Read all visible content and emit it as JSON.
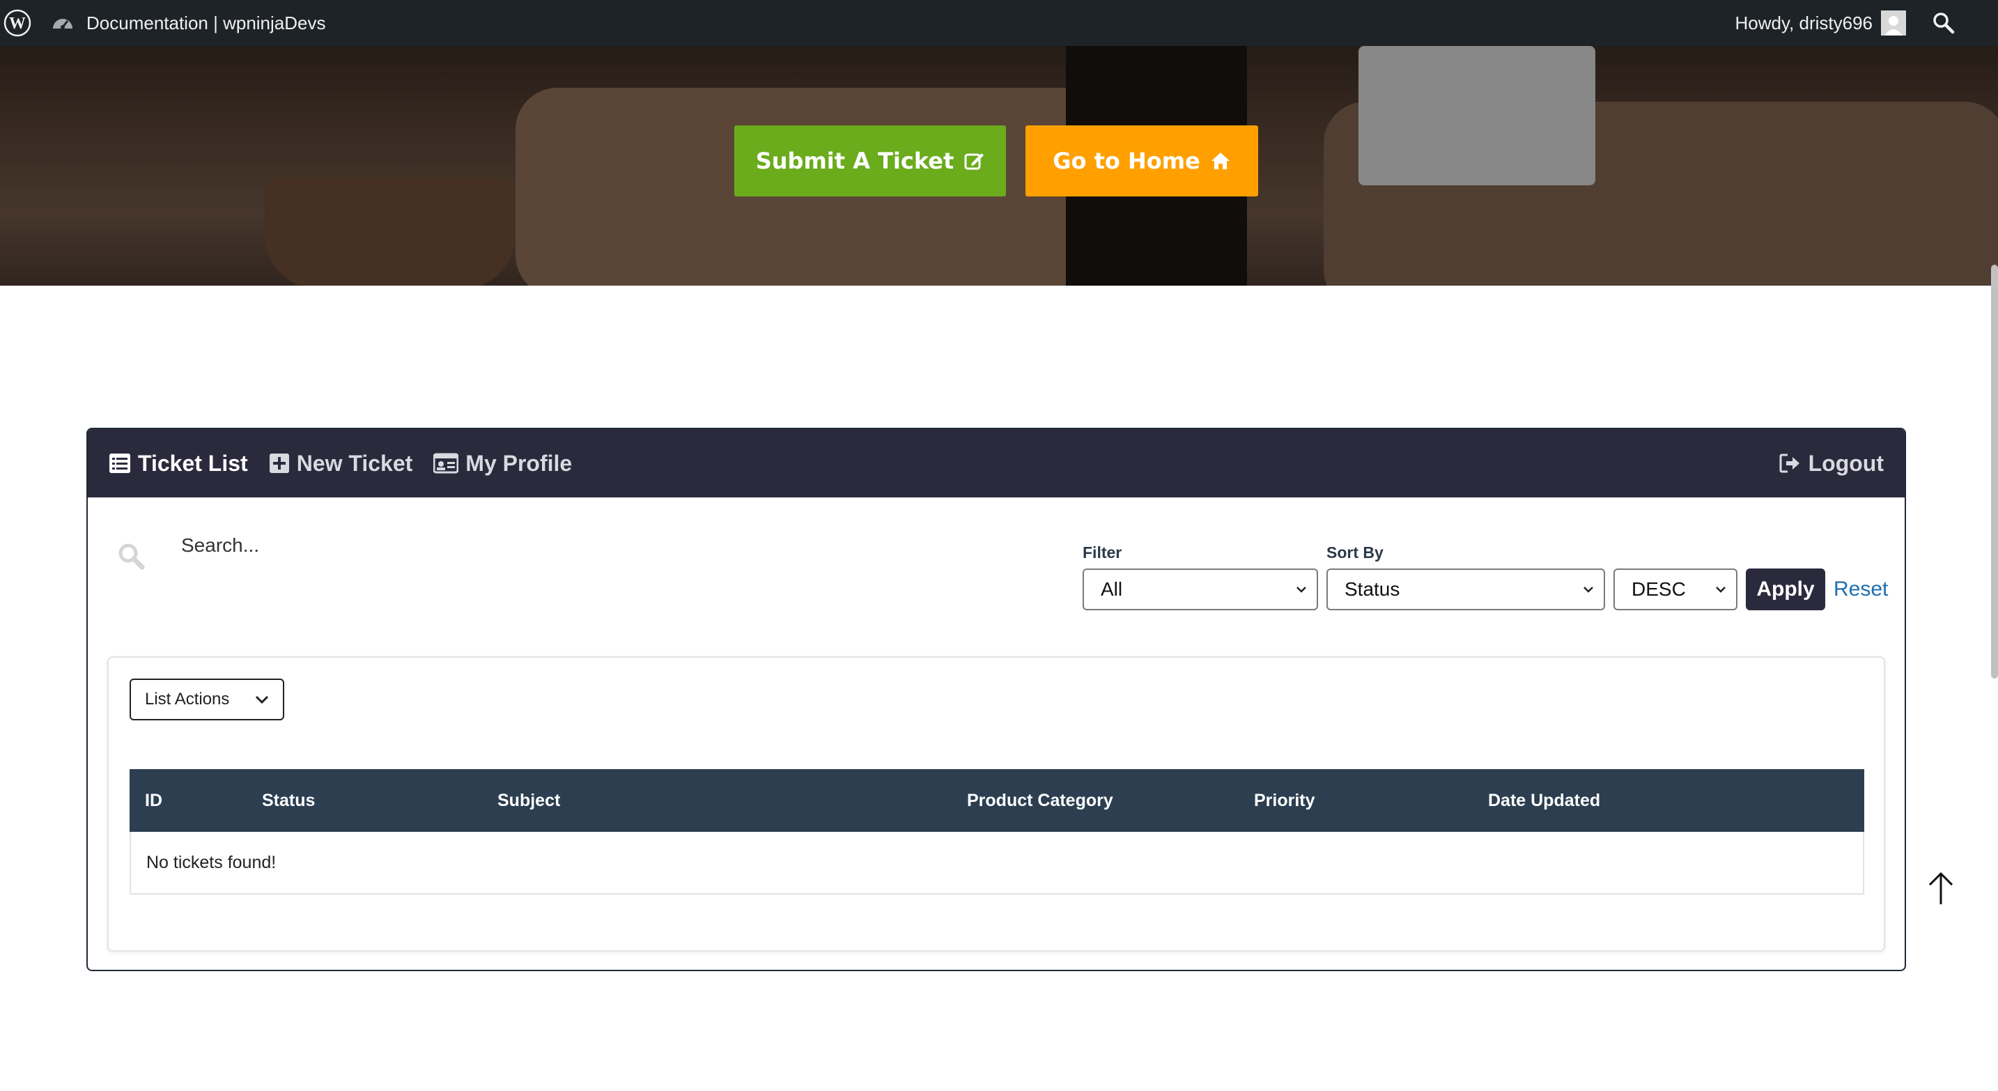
{
  "admin_bar": {
    "site_title": "Documentation | wpninjaDevs",
    "greeting": "Howdy, dristy696"
  },
  "hero": {
    "submit_ticket_label": "Submit A Ticket",
    "go_home_label": "Go to Home"
  },
  "panel": {
    "tabs": [
      {
        "label": "Ticket List",
        "icon": "list-icon",
        "active": true
      },
      {
        "label": "New Ticket",
        "icon": "plus-square-icon",
        "active": false
      },
      {
        "label": "My Profile",
        "icon": "id-card-icon",
        "active": false
      }
    ],
    "logout_label": "Logout",
    "search": {
      "placeholder": "Search...",
      "value": ""
    },
    "filter": {
      "label": "Filter",
      "value": "All"
    },
    "sort_by": {
      "label": "Sort By",
      "value": "Status"
    },
    "order": {
      "value": "DESC"
    },
    "apply_label": "Apply",
    "reset_label": "Reset",
    "list_actions_label": "List Actions",
    "table": {
      "columns": [
        "ID",
        "Status",
        "Subject",
        "Product Category",
        "Priority",
        "Date Updated"
      ],
      "empty_message": "No tickets found!"
    }
  },
  "colors": {
    "admin_bar": "#1d2327",
    "submit_button": "#6aac1c",
    "home_button": "#ffa000",
    "panel_header": "#2b2a3d",
    "table_header": "#2c3e50",
    "reset_link": "#1e6fb0"
  }
}
